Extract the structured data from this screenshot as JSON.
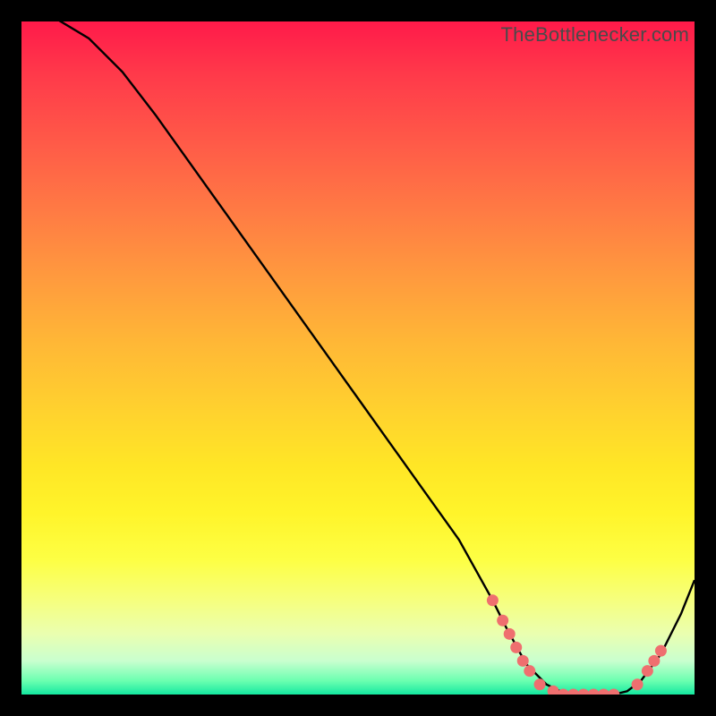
{
  "watermark": "TheBottlenecker.com",
  "chart_data": {
    "type": "line",
    "title": "",
    "xlabel": "",
    "ylabel": "",
    "xlim": [
      0,
      100
    ],
    "ylim": [
      0,
      100
    ],
    "grid": false,
    "series": [
      {
        "name": "curve",
        "x": [
          0,
          2,
          5,
          10,
          15,
          20,
          25,
          30,
          35,
          40,
          45,
          50,
          55,
          60,
          65,
          70,
          72,
          75,
          78,
          80,
          82,
          85,
          88,
          90,
          92,
          95,
          98,
          100
        ],
        "y": [
          102,
          101.5,
          100.5,
          97.5,
          92.5,
          86,
          79,
          72,
          65,
          58,
          51,
          44,
          37,
          30,
          23,
          14,
          10,
          4.5,
          1.5,
          0.5,
          0,
          0,
          0,
          0.5,
          2,
          6,
          12,
          17
        ],
        "color": "#000000"
      }
    ],
    "markers": [
      {
        "x": 70.0,
        "y": 14.0
      },
      {
        "x": 71.5,
        "y": 11.0
      },
      {
        "x": 72.5,
        "y": 9.0
      },
      {
        "x": 73.5,
        "y": 7.0
      },
      {
        "x": 74.5,
        "y": 5.0
      },
      {
        "x": 75.5,
        "y": 3.5
      },
      {
        "x": 77.0,
        "y": 1.5
      },
      {
        "x": 79.0,
        "y": 0.5
      },
      {
        "x": 80.5,
        "y": 0.0
      },
      {
        "x": 82.0,
        "y": 0.0
      },
      {
        "x": 83.5,
        "y": 0.0
      },
      {
        "x": 85.0,
        "y": 0.0
      },
      {
        "x": 86.5,
        "y": 0.0
      },
      {
        "x": 88.0,
        "y": 0.0
      },
      {
        "x": 91.5,
        "y": 1.5
      },
      {
        "x": 93.0,
        "y": 3.5
      },
      {
        "x": 94.0,
        "y": 5.0
      },
      {
        "x": 95.0,
        "y": 6.5
      }
    ],
    "marker_color": "#ef6f6f",
    "gradient": {
      "top": "#ff1a4a",
      "mid": "#ffd22e",
      "bottom": "#14e8a0"
    }
  }
}
